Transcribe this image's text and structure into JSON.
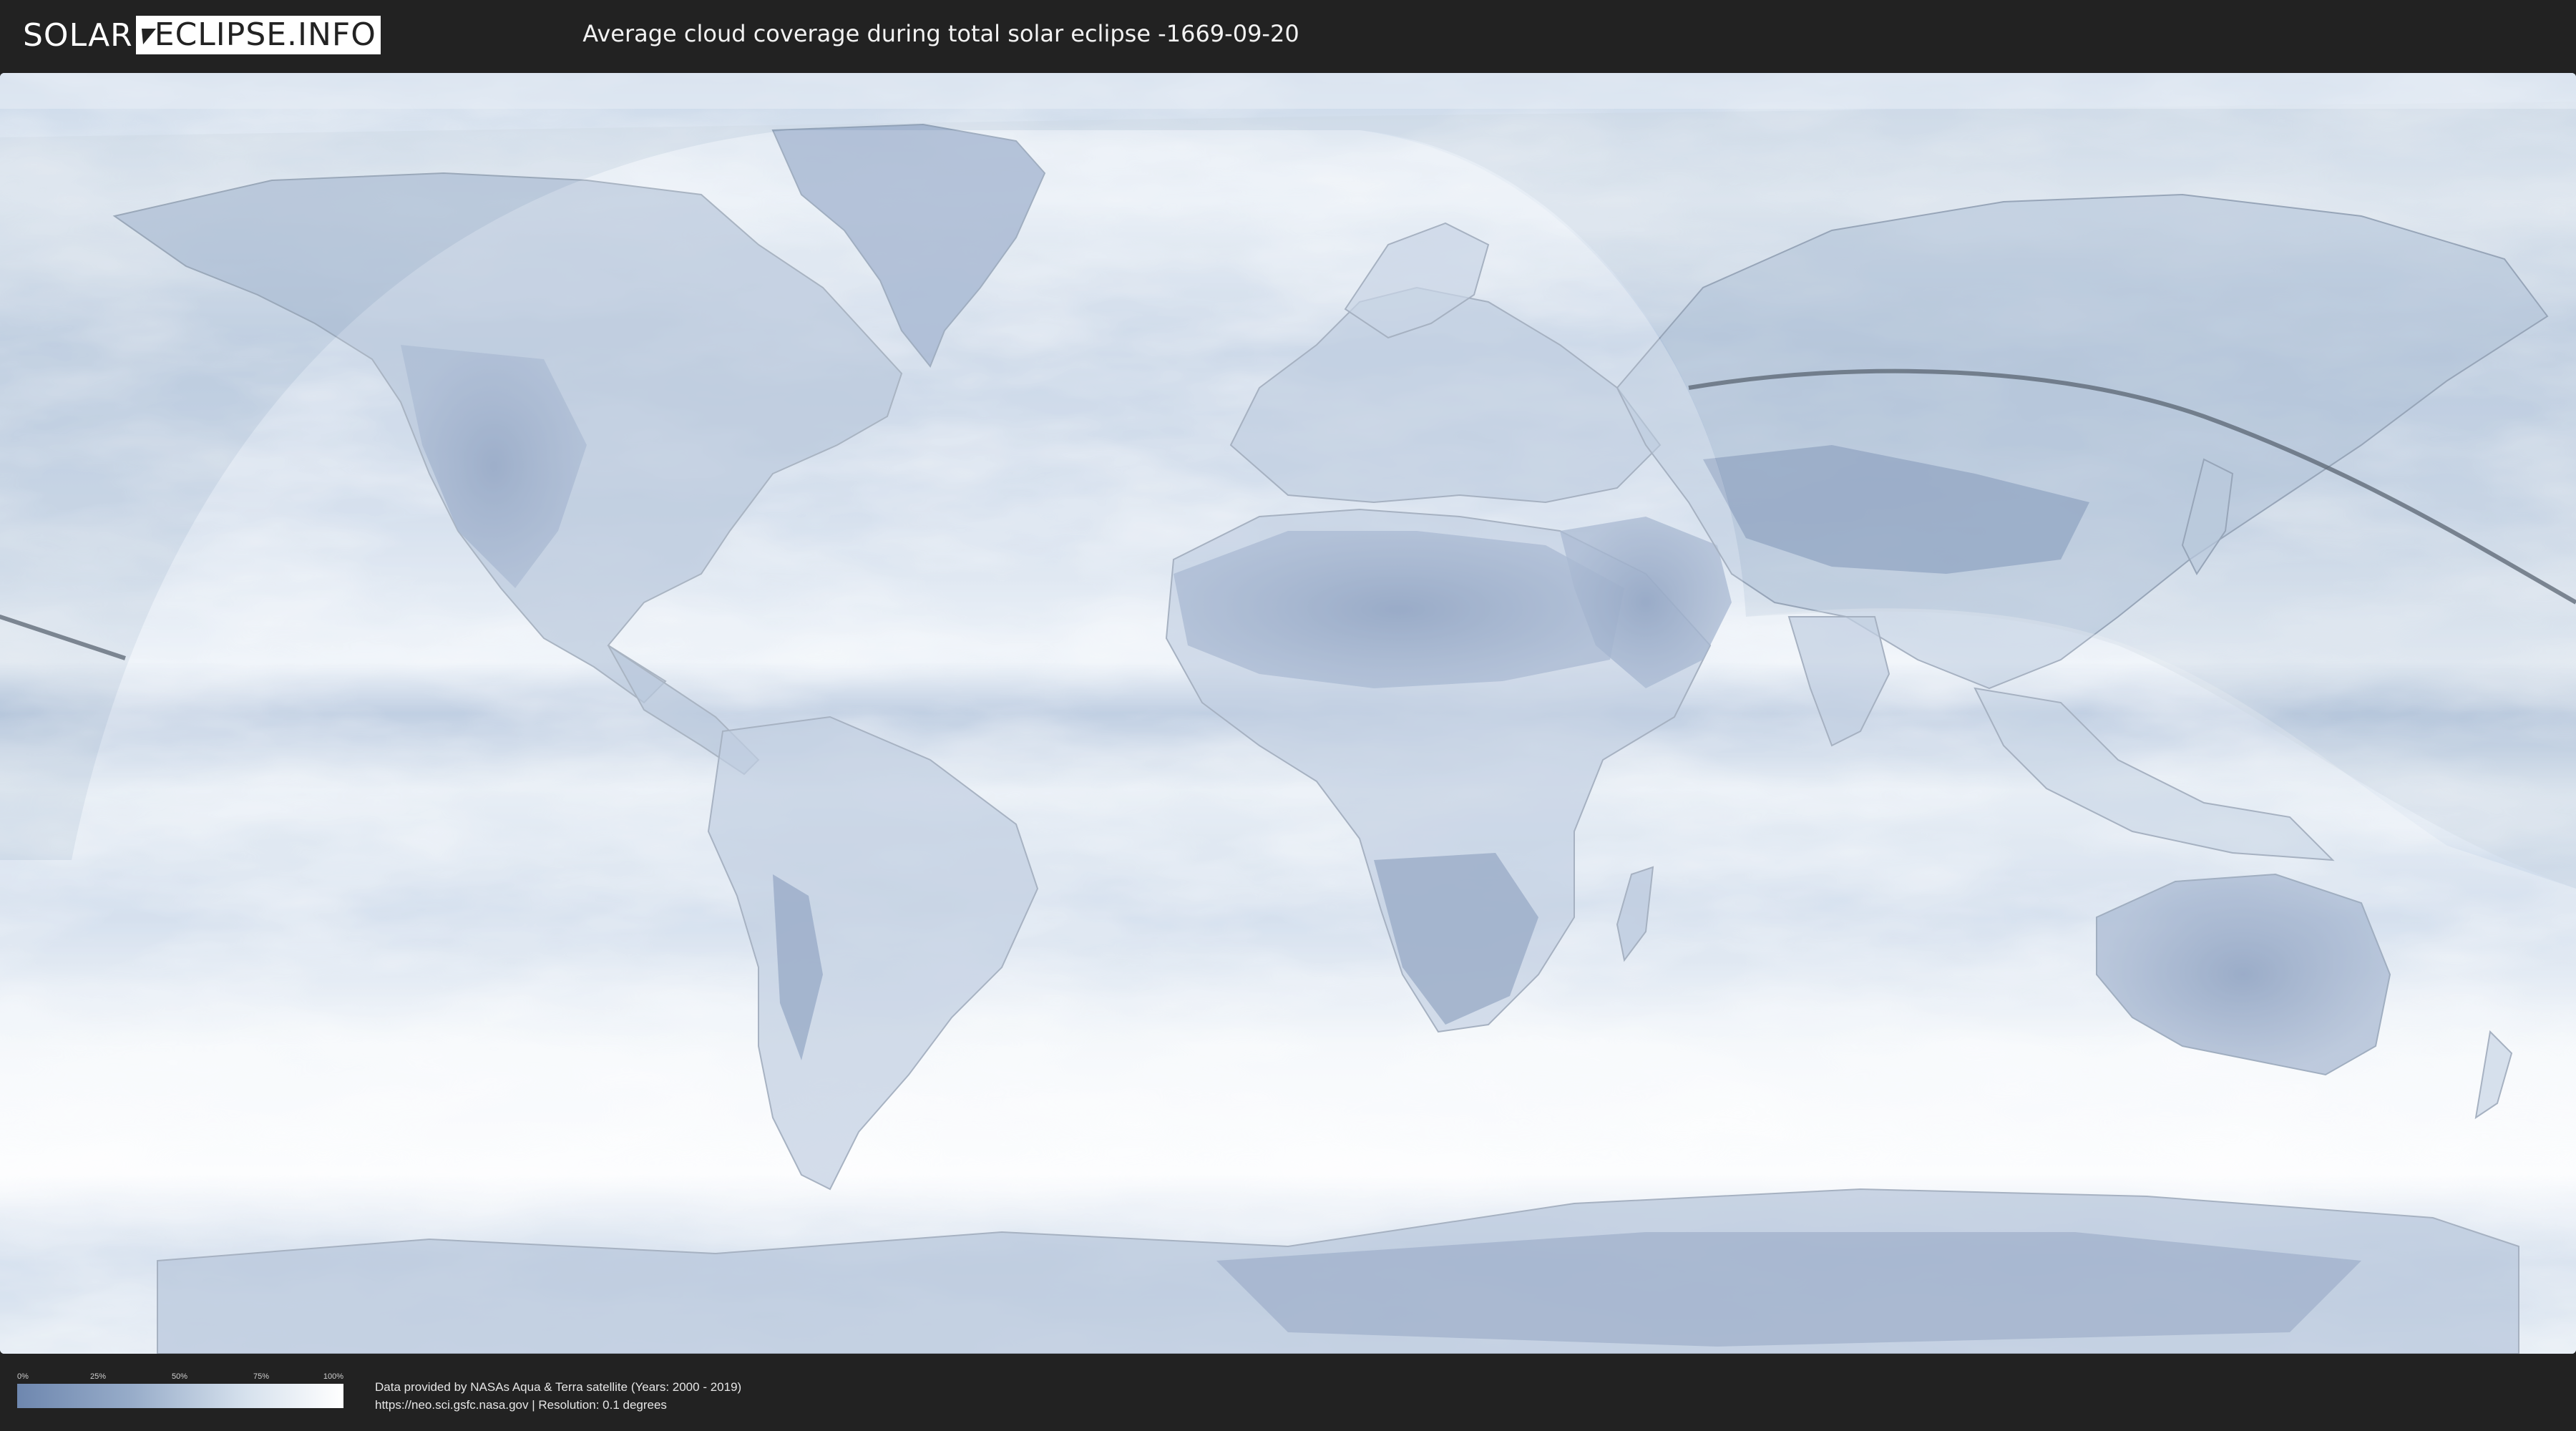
{
  "header": {
    "logo_left": "SOLAR",
    "logo_right": "ECLIPSE.INFO",
    "title": "Average cloud coverage during total solar eclipse -1669-09-20"
  },
  "legend": {
    "ticks": [
      "0%",
      "25%",
      "50%",
      "75%",
      "100%"
    ],
    "colors": {
      "low": "#6e87af",
      "high": "#ffffff"
    }
  },
  "credits": {
    "line1": "Data provided by NASAs Aqua & Terra satellite (Years: 2000 - 2019)",
    "line2": "https://neo.sci.gsfc.nasa.gov | Resolution: 0.1 degrees"
  },
  "map": {
    "layers": [
      "cloud-coverage",
      "country-borders",
      "eclipse-visibility-zone",
      "eclipse-path"
    ],
    "colors": {
      "background": "#dbe6f1",
      "clear_sky": "#6f88b0",
      "overcast": "#ffffff",
      "eclipse_path": "#5a6472"
    }
  }
}
